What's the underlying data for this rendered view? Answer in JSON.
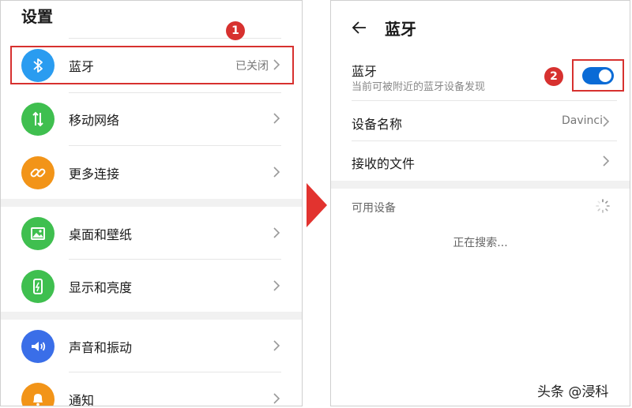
{
  "left": {
    "title": "设置",
    "items": [
      {
        "label": "蓝牙",
        "value": "已关闭",
        "icon": "bluetooth-icon",
        "color": "#2a9cf0"
      },
      {
        "label": "移动网络",
        "icon": "mobile-data-icon",
        "color": "#3fbf4f"
      },
      {
        "label": "更多连接",
        "icon": "link-icon",
        "color": "#f29418"
      },
      {
        "label": "桌面和壁纸",
        "icon": "wallpaper-icon",
        "color": "#3fbf4f"
      },
      {
        "label": "显示和亮度",
        "icon": "phone-brightness-icon",
        "color": "#3fbf4f"
      },
      {
        "label": "声音和振动",
        "icon": "speaker-icon",
        "color": "#3a6ee8"
      },
      {
        "label": "通知",
        "icon": "bell-icon",
        "color": "#f29418"
      }
    ]
  },
  "annotations": {
    "step1": "1",
    "step2": "2",
    "highlight_color": "#d7312f",
    "arrow_color": "#e2332f"
  },
  "right": {
    "title": "蓝牙",
    "bluetooth": {
      "label": "蓝牙",
      "sub": "当前可被附近的蓝牙设备发现",
      "enabled": true,
      "toggle_color": "#0a6bd6"
    },
    "device_name": {
      "label": "设备名称",
      "value": "Davinci"
    },
    "received_files": {
      "label": "接收的文件"
    },
    "available_devices": {
      "label": "可用设备",
      "status": "正在搜索..."
    }
  },
  "watermark": "头条 @浸科"
}
